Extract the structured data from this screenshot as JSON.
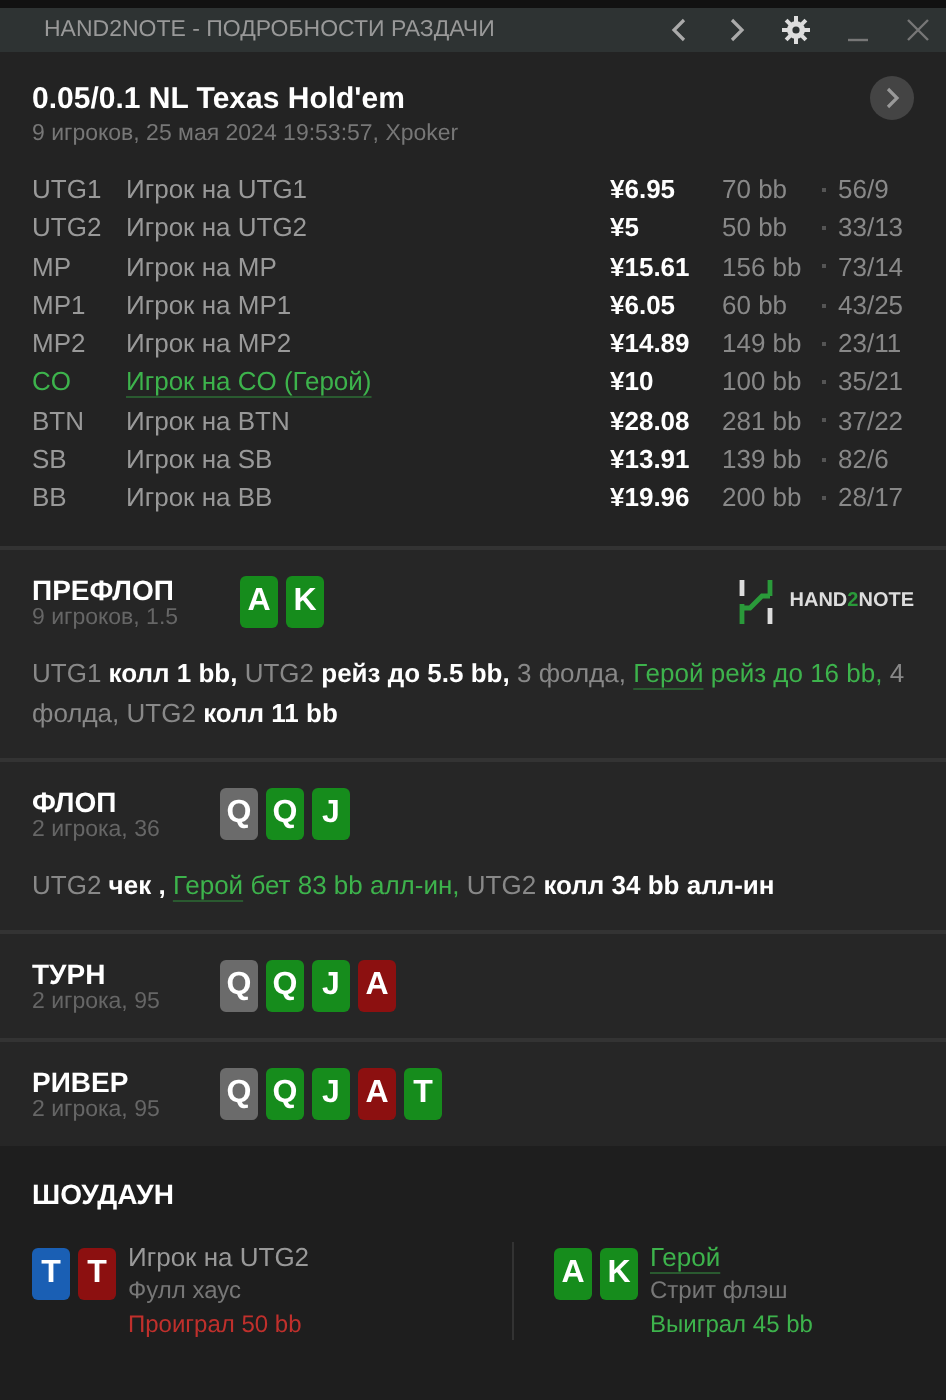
{
  "window": {
    "title": "HAND2NOTE - ПОДРОБНОСТИ РАЗДАЧИ"
  },
  "hand": {
    "title": "0.05/0.1 NL Texas Hold'em",
    "subtitle": "9 игроков, 25 мая 2024 19:53:57, Xpoker"
  },
  "players": [
    {
      "position": "UTG1",
      "name": "Игрок на UTG1",
      "stack": "¥6.95",
      "bb": "70 bb",
      "stats": "56/9",
      "hero": false
    },
    {
      "position": "UTG2",
      "name": "Игрок на UTG2",
      "stack": "¥5",
      "bb": "50 bb",
      "stats": "33/13",
      "hero": false
    },
    {
      "position": "MP",
      "name": "Игрок на MP",
      "stack": "¥15.61",
      "bb": "156 bb",
      "stats": "73/14",
      "hero": false
    },
    {
      "position": "MP1",
      "name": "Игрок на MP1",
      "stack": "¥6.05",
      "bb": "60 bb",
      "stats": "43/25",
      "hero": false
    },
    {
      "position": "MP2",
      "name": "Игрок на MP2",
      "stack": "¥14.89",
      "bb": "149 bb",
      "stats": "23/11",
      "hero": false
    },
    {
      "position": "CO",
      "name": "Игрок на CO (Герой)",
      "stack": "¥10",
      "bb": "100 bb",
      "stats": "35/21",
      "hero": true
    },
    {
      "position": "BTN",
      "name": "Игрок на BTN",
      "stack": "¥28.08",
      "bb": "281 bb",
      "stats": "37/22",
      "hero": false
    },
    {
      "position": "SB",
      "name": "Игрок на SB",
      "stack": "¥13.91",
      "bb": "139 bb",
      "stats": "82/6",
      "hero": false
    },
    {
      "position": "BB",
      "name": "Игрок на BB",
      "stack": "¥19.96",
      "bb": "200 bb",
      "stats": "28/17",
      "hero": false
    }
  ],
  "logo": {
    "text_before": "HAND",
    "accent": "2",
    "text_after": "NOTE"
  },
  "streets": [
    {
      "name": "ПРЕФЛОП",
      "info": "9 игроков, 1.5",
      "cards": [
        {
          "rank": "A",
          "color": "#168c1c"
        },
        {
          "rank": "K",
          "color": "#168c1c"
        }
      ],
      "actions": [
        {
          "text": "UTG1",
          "kind": "player",
          "hero": false
        },
        {
          "text": "колл 1 bb,",
          "kind": "action",
          "hero": false
        },
        {
          "text": "UTG2",
          "kind": "player",
          "hero": false
        },
        {
          "text": "рейз до 5.5 bb,",
          "kind": "action",
          "hero": false
        },
        {
          "text": "3 фолда,",
          "kind": "muted",
          "hero": false
        },
        {
          "text": "Герой",
          "kind": "player",
          "hero": true
        },
        {
          "text": "рейз до 16 bb,",
          "kind": "action",
          "hero": true
        },
        {
          "text": "4 фолда,",
          "kind": "muted",
          "hero": false
        },
        {
          "text": "UTG2",
          "kind": "player",
          "hero": false
        },
        {
          "text": "колл 11 bb",
          "kind": "action",
          "hero": false
        }
      ]
    },
    {
      "name": "ФЛОП",
      "info": "2 игрока, 36",
      "cards": [
        {
          "rank": "Q",
          "color": "#6b6b6b"
        },
        {
          "rank": "Q",
          "color": "#168c1c"
        },
        {
          "rank": "J",
          "color": "#168c1c"
        }
      ],
      "actions": [
        {
          "text": "UTG2",
          "kind": "player",
          "hero": false
        },
        {
          "text": "чек ,",
          "kind": "action",
          "hero": false
        },
        {
          "text": "Герой",
          "kind": "player",
          "hero": true
        },
        {
          "text": "бет 83 bb алл-ин,",
          "kind": "action",
          "hero": true
        },
        {
          "text": "UTG2",
          "kind": "player",
          "hero": false
        },
        {
          "text": "колл 34 bb алл-ин",
          "kind": "action",
          "hero": false
        }
      ]
    },
    {
      "name": "ТУРН",
      "info": "2 игрока, 95",
      "cards": [
        {
          "rank": "Q",
          "color": "#6b6b6b"
        },
        {
          "rank": "Q",
          "color": "#168c1c"
        },
        {
          "rank": "J",
          "color": "#168c1c"
        },
        {
          "rank": "A",
          "color": "#8c1010"
        }
      ]
    },
    {
      "name": "РИВЕР",
      "info": "2 игрока, 95",
      "cards": [
        {
          "rank": "Q",
          "color": "#6b6b6b"
        },
        {
          "rank": "Q",
          "color": "#168c1c"
        },
        {
          "rank": "J",
          "color": "#168c1c"
        },
        {
          "rank": "A",
          "color": "#8c1010"
        },
        {
          "rank": "T",
          "color": "#168c1c"
        }
      ]
    }
  ],
  "showdown": {
    "title": "ШОУДАУН",
    "hands": [
      {
        "cards": [
          {
            "rank": "T",
            "color": "#1a5fb4"
          },
          {
            "rank": "T",
            "color": "#8c1010"
          }
        ],
        "player": "Игрок на UTG2",
        "hero": false,
        "combo": "Фулл хаус",
        "result": "Проиграл 50 bb",
        "won": false
      },
      {
        "cards": [
          {
            "rank": "A",
            "color": "#168c1c"
          },
          {
            "rank": "K",
            "color": "#168c1c"
          }
        ],
        "player": "Герой",
        "hero": true,
        "combo": "Стрит флэш",
        "result": "Выиграл 45 bb",
        "won": true
      }
    ]
  }
}
